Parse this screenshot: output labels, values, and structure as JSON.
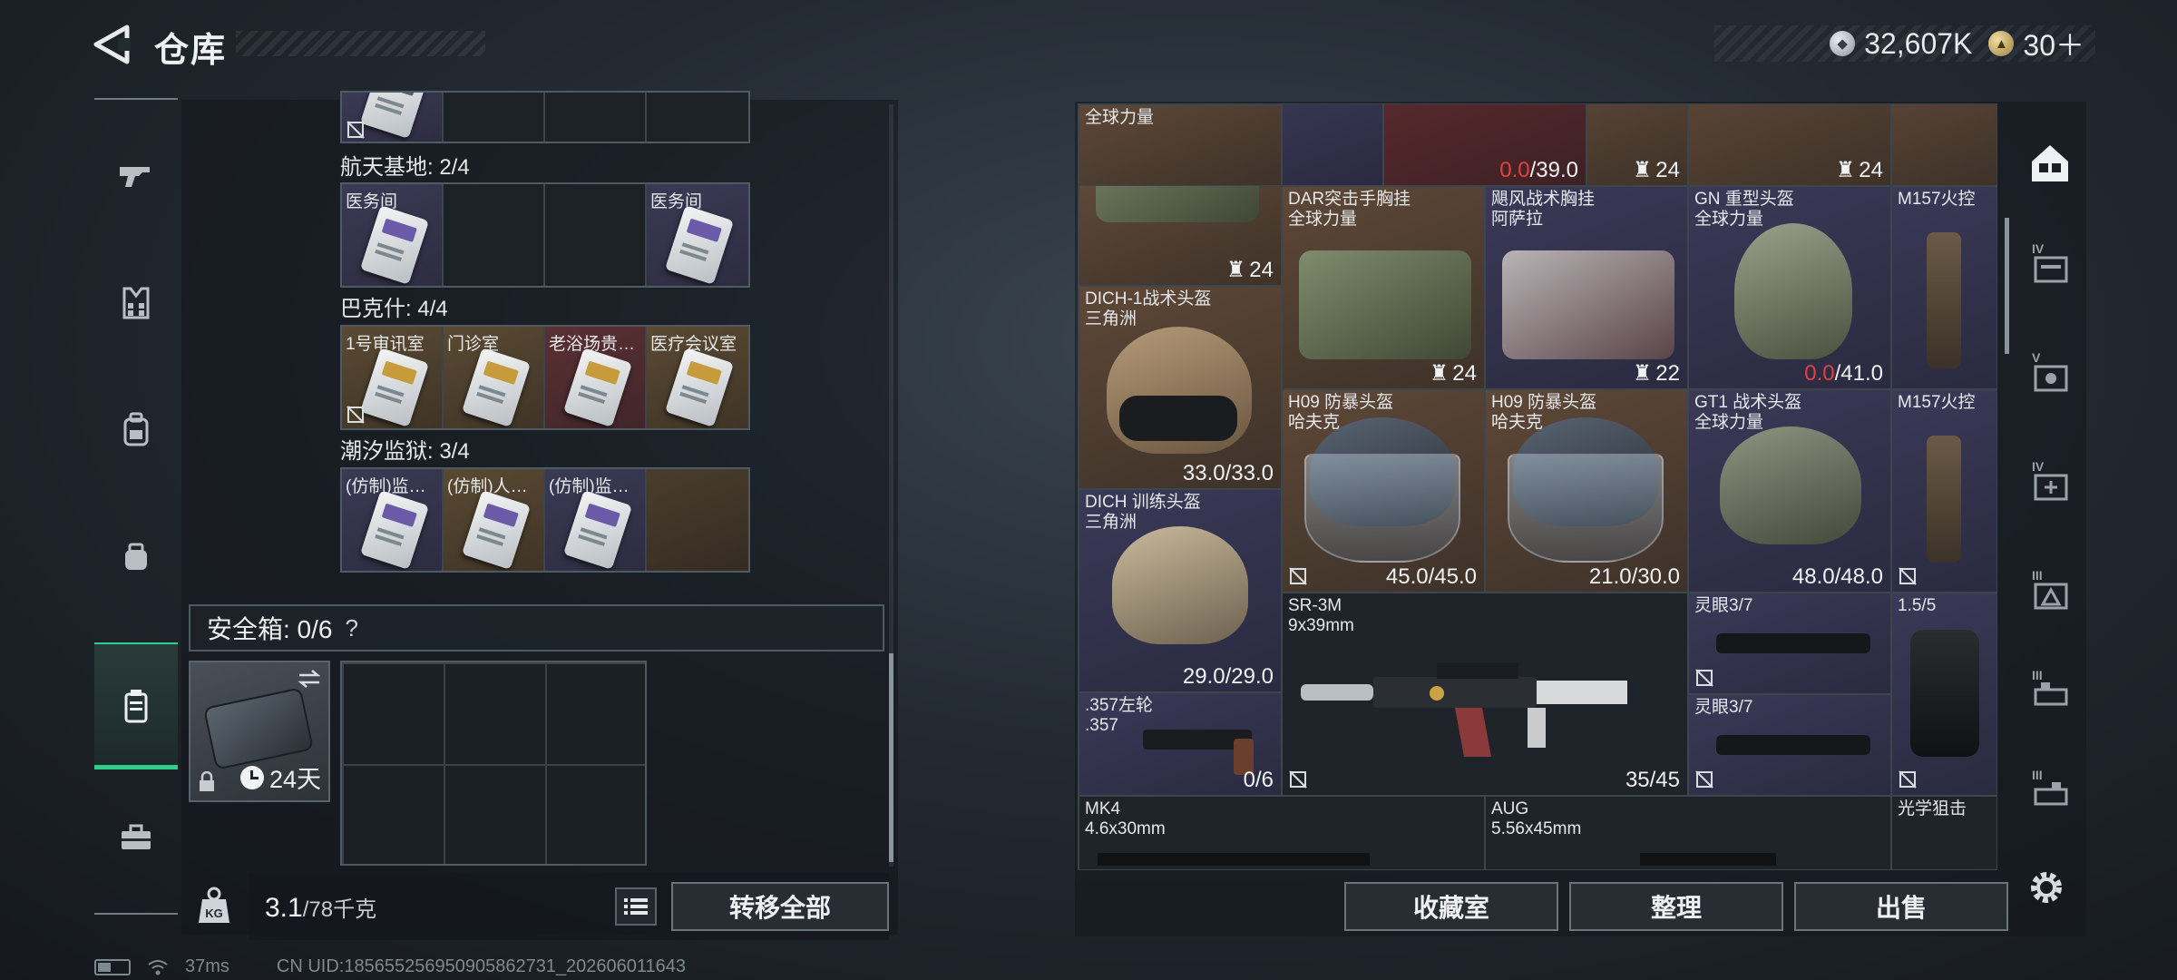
{
  "header": {
    "title": "仓库",
    "currency_silver": "32,607K",
    "currency_gold": "30＋"
  },
  "left_nav": {
    "items": [
      "weapon-icon",
      "armor-vest-icon",
      "backpack-icon",
      "pouch-icon",
      "safe-case-icon",
      "toolbox-icon"
    ],
    "active_index": 4
  },
  "keys": {
    "sections": [
      {
        "title": "航天基地: 2/4",
        "cells": [
          {
            "label": "医务间",
            "rarity": "purple"
          },
          {
            "label": "",
            "rarity": "empty"
          },
          {
            "label": "",
            "rarity": "empty"
          },
          {
            "label": "医务间",
            "rarity": "purple"
          }
        ]
      },
      {
        "title": "巴克什: 4/4",
        "cells": [
          {
            "label": "1号审讯室",
            "rarity": "gold"
          },
          {
            "label": "门诊室",
            "rarity": "gold"
          },
          {
            "label": "老浴场贵…",
            "rarity": "red"
          },
          {
            "label": "医疗会议室",
            "rarity": "gold"
          }
        ]
      },
      {
        "title": "潮汐监狱: 3/4",
        "cells": [
          {
            "label": "(仿制)监…",
            "rarity": "purple"
          },
          {
            "label": "(仿制)人…",
            "rarity": "gold"
          },
          {
            "label": "(仿制)监…",
            "rarity": "purple"
          },
          {
            "label": "",
            "rarity": "empty"
          }
        ]
      }
    ]
  },
  "safe_box": {
    "title": "安全箱: 0/6",
    "help": "?",
    "timer": "24天"
  },
  "weight": {
    "current": "3.1",
    "max_unit": "/78千克"
  },
  "buttons": {
    "transfer_all": "转移全部",
    "collection_room": "收藏室",
    "organize": "整理",
    "sell": "出售"
  },
  "status": {
    "ping": "37ms",
    "uid": "CN UID:1856552569509058627​31_202606011643"
  },
  "stash": {
    "top_row": {
      "partial_label": "全球力量",
      "durability_red": "0.0",
      "durability_max": "/39.0",
      "qty_a": "24",
      "qty_b": "24"
    },
    "items": [
      {
        "name": "",
        "sub": "",
        "qty": "24"
      },
      {
        "name": "DAR突击手胸挂",
        "sub": "全球力量",
        "qty": "24"
      },
      {
        "name": "飓风战术胸挂",
        "sub": "阿萨拉",
        "qty": "22"
      },
      {
        "name": "GN 重型头盔",
        "sub": "全球力量",
        "dur_bad": "0.0",
        "dur_max": "/41.0"
      },
      {
        "name": "M157火控",
        "sub": ""
      },
      {
        "name": "DICH-1战术头盔",
        "sub": "三角洲",
        "dur": "33.0/33.0"
      },
      {
        "name": "H09 防暴头盔",
        "sub": "哈夫克",
        "dur": "45.0/45.0"
      },
      {
        "name": "H09 防暴头盔",
        "sub": "哈夫克",
        "dur": "21.0/30.0"
      },
      {
        "name": "GT1 战术头盔",
        "sub": "全球力量",
        "dur": "48.0/48.0"
      },
      {
        "name": "M157火控",
        "sub": ""
      },
      {
        "name": "DICH 训练头盔",
        "sub": "三角洲",
        "dur": "29.0/29.0"
      },
      {
        "name": "SR-3M",
        "sub": "9x39mm",
        "ammo": "35/45"
      },
      {
        "name": "灵眼3/7",
        "sub": ""
      },
      {
        "name": "1.5/5",
        "sub": ""
      },
      {
        "name": ".357左轮",
        "sub": ".357",
        "ammo": "0/6"
      },
      {
        "name": "灵眼3/7",
        "sub": ""
      },
      {
        "name": "MK4",
        "sub": "4.6x30mm"
      },
      {
        "name": "AUG",
        "sub": "5.56x45mm"
      },
      {
        "name": "光学狙击",
        "sub": ""
      }
    ]
  },
  "right_rail": {
    "tags": [
      "IV",
      "V",
      "IV",
      "III",
      "III",
      "III"
    ],
    "icons": [
      "stash-home-icon",
      "stash-tier-4-icon",
      "stash-tier-5-icon",
      "stash-tier-4-plus-icon",
      "stash-tier-3-icon",
      "stash-tier-3b-icon",
      "stash-tier-3c-icon",
      "settings-gear-icon"
    ]
  },
  "colors": {
    "accent_green": "#2fd08a",
    "bad_red": "#e0423f",
    "gold_rarity": "#5a4a33",
    "purple_rarity": "#3b3a55",
    "red_rarity": "#5a3033"
  }
}
